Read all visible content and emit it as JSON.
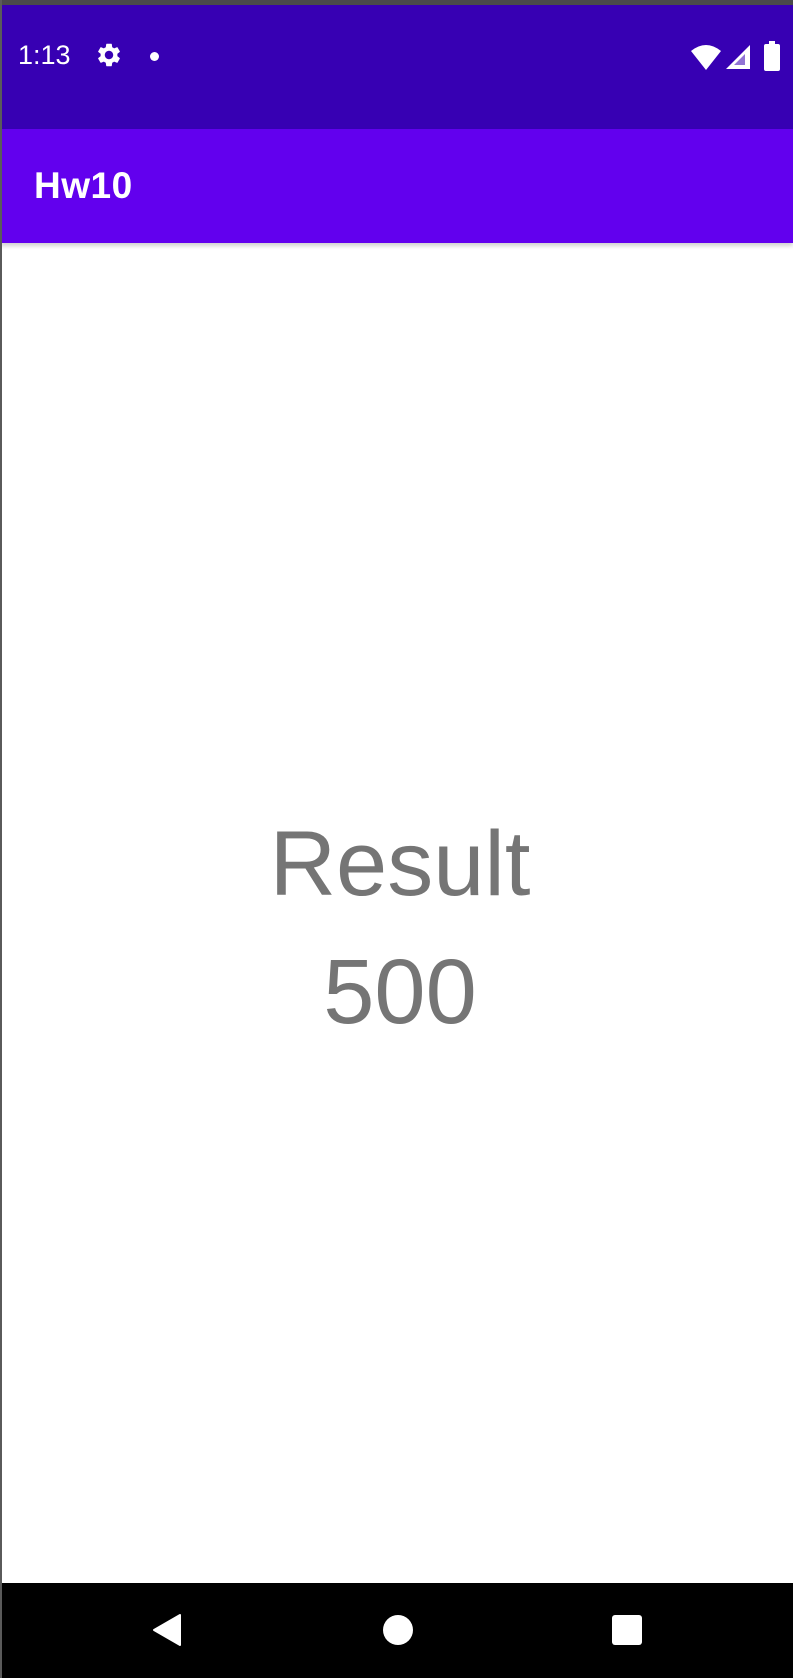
{
  "status_bar": {
    "time": "1:13",
    "icons": [
      "gear-icon",
      "notification-dot-icon",
      "wifi-icon",
      "signal-icon",
      "battery-icon"
    ],
    "background_color": "#3700b3"
  },
  "app_bar": {
    "title": "Hw10",
    "background_color": "#6200ee"
  },
  "main": {
    "result_label": "Result",
    "result_value": "500",
    "text_color": "#757575"
  },
  "nav_bar": {
    "buttons": [
      "back-icon",
      "home-icon",
      "recents-icon"
    ]
  }
}
